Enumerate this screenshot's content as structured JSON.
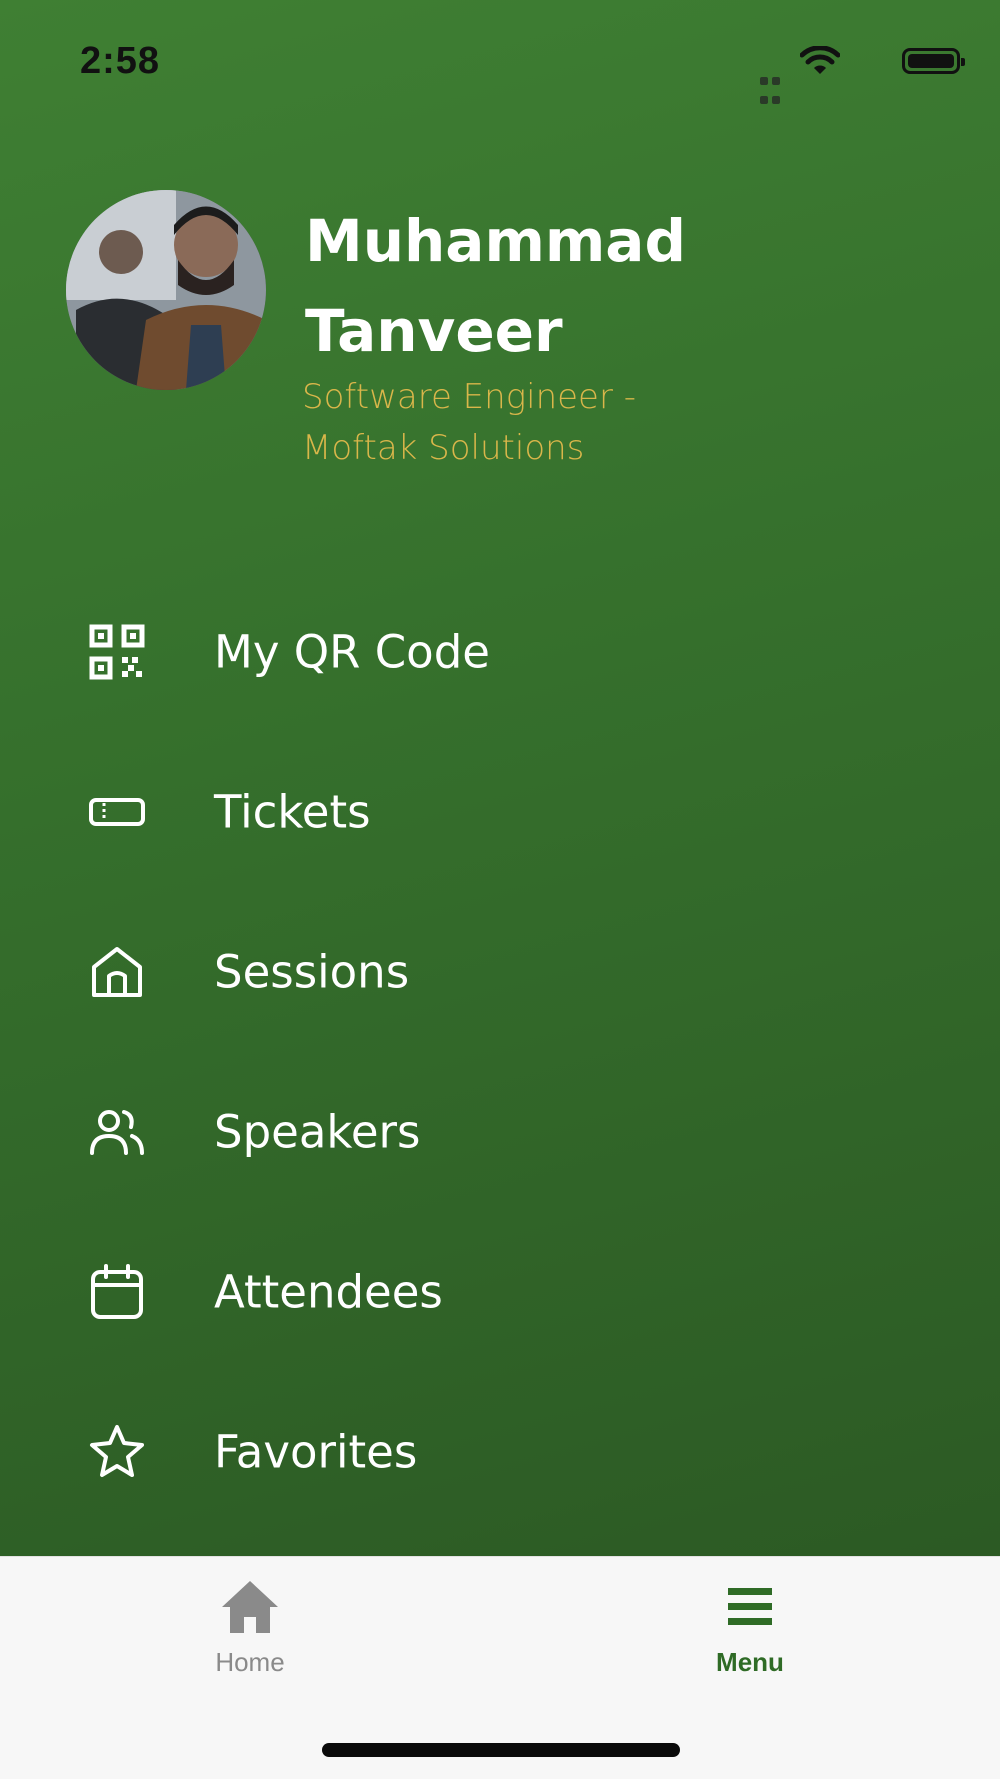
{
  "status_bar": {
    "time": "2:58"
  },
  "profile": {
    "name": "Muhammad Tanveer",
    "title": "Software Engineer - Moftak Solutions",
    "avatar": "avatar-photo"
  },
  "menu": {
    "items": [
      {
        "label": "My QR Code",
        "icon": "qr-code-icon"
      },
      {
        "label": "Tickets",
        "icon": "ticket-icon"
      },
      {
        "label": "Sessions",
        "icon": "home-outline-icon"
      },
      {
        "label": "Speakers",
        "icon": "users-icon"
      },
      {
        "label": "Attendees",
        "icon": "calendar-icon"
      },
      {
        "label": "Favorites",
        "icon": "star-icon"
      }
    ]
  },
  "tab_bar": {
    "tabs": [
      {
        "label": "Home",
        "icon": "home-icon",
        "active": false
      },
      {
        "label": "Menu",
        "icon": "menu-icon",
        "active": true
      }
    ]
  },
  "colors": {
    "background_top": "#3f7f33",
    "background_bottom": "#2c5a24",
    "title_accent": "#d9b64a",
    "tab_active": "#2f6b26",
    "tab_inactive": "#8a8a8a"
  }
}
